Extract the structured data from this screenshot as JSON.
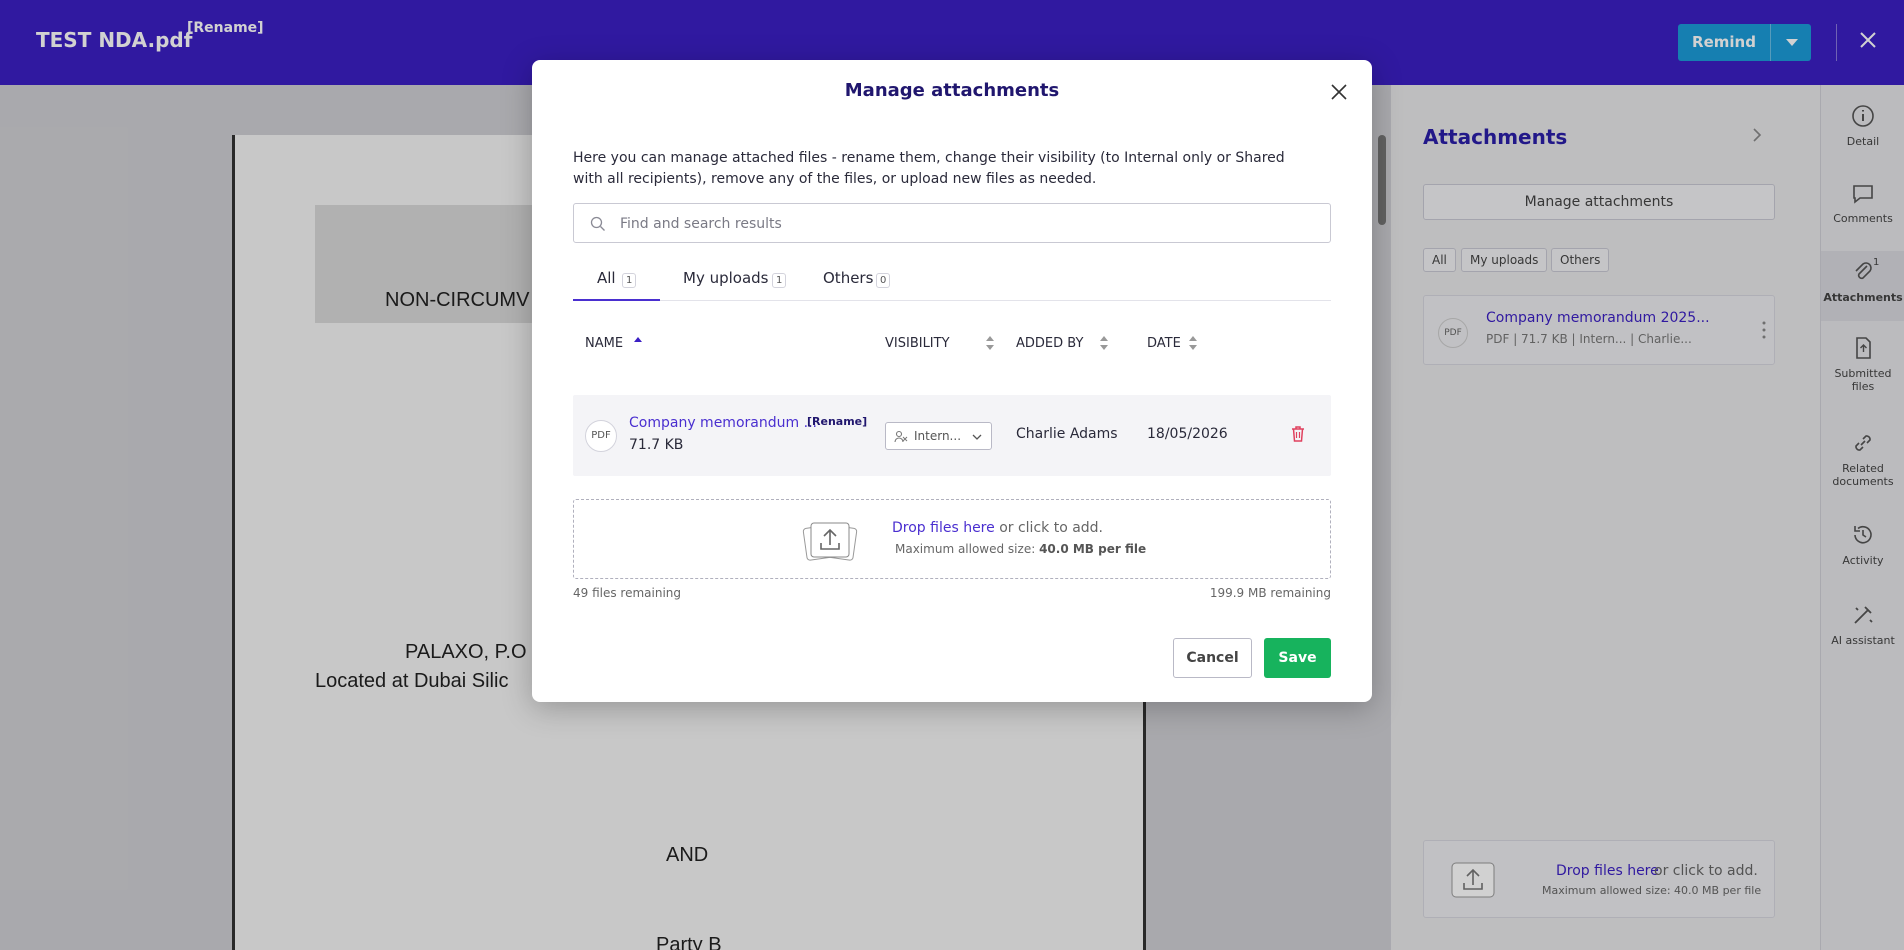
{
  "topbar": {
    "doc_title": "TEST NDA.pdf",
    "rename_label": "[Rename]",
    "remind_label": "Remind",
    "accent": "#3b1fc4",
    "remind_color": "#1b9bd8"
  },
  "document": {
    "line1": "NON-CIRCUMV",
    "line2": "PALAXO, P.O",
    "line3": "Located at Dubai Silic",
    "line4": "AND",
    "line5": "Party B"
  },
  "side_panel": {
    "title": "Attachments",
    "manage_label": "Manage attachments",
    "chips": [
      "All",
      "My uploads",
      "Others"
    ],
    "file_name": "Company memorandum 2025...",
    "file_meta": "PDF | 71.7 KB | Intern... | Charlie...",
    "file_badge": "PDF",
    "drop_link": "Drop files here",
    "drop_rest": "or click to add.",
    "drop_limit": "Maximum allowed size: 40.0 MB per file"
  },
  "rail": {
    "items": [
      {
        "label": "Detail",
        "icon": "info-icon"
      },
      {
        "label": "Comments",
        "icon": "comment-icon"
      },
      {
        "label": "Attachments",
        "icon": "paperclip-icon",
        "count": "1"
      },
      {
        "label": "Submitted files",
        "icon": "file-icon"
      },
      {
        "label": "Related documents",
        "icon": "link-icon"
      },
      {
        "label": "Activity",
        "icon": "history-icon"
      },
      {
        "label": "AI assistant",
        "icon": "ai-icon"
      }
    ]
  },
  "modal": {
    "title": "Manage attachments",
    "description": "Here you can manage attached files - rename them, change their visibility (to Internal only or Shared with all recipients), remove any of the files, or upload new files as needed.",
    "search_placeholder": "Find and search results",
    "tabs": [
      {
        "label": "All",
        "count": "1"
      },
      {
        "label": "My uploads",
        "count": "1"
      },
      {
        "label": "Others",
        "count": "0"
      }
    ],
    "columns": {
      "name": "NAME",
      "visibility": "VISIBILITY",
      "added_by": "ADDED BY",
      "date": "DATE"
    },
    "rows": [
      {
        "badge": "PDF",
        "name": "Company memorandum ...",
        "rename": "[Rename]",
        "size": "71.7 KB",
        "visibility": "Intern...",
        "added_by": "Charlie Adams",
        "date": "18/05/2026"
      }
    ],
    "dropzone": {
      "link": "Drop files here",
      "rest": " or click to add.",
      "limit_prefix": "Maximum allowed size: ",
      "limit_value": "40.0 MB per file"
    },
    "files_remaining": "49 files remaining",
    "size_remaining": "199.9 MB remaining",
    "cancel_label": "Cancel",
    "save_label": "Save",
    "save_color": "#17b35d"
  }
}
